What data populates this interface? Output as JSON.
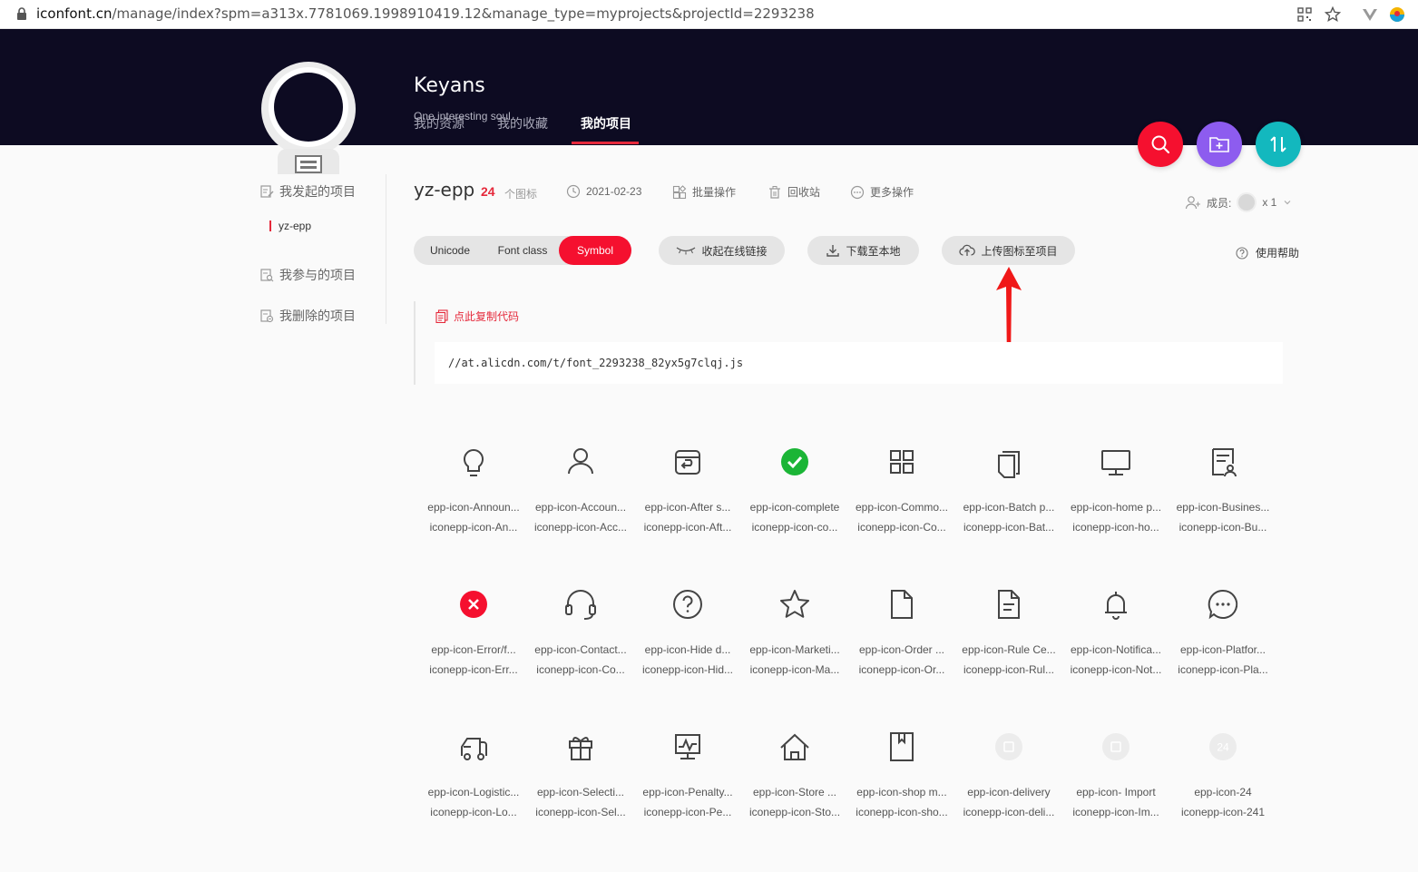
{
  "browser": {
    "url_domain": "iconfont.cn",
    "url_rest": "/manage/index?spm=a313x.7781069.1998910419.12&manage_type=myprojects&projectId=2293238"
  },
  "header": {
    "username": "Keyans",
    "tagline": "One interesting soul",
    "nav": [
      "我的资源",
      "我的收藏",
      "我的项目"
    ]
  },
  "sidebar": {
    "initiated": "我发起的项目",
    "project": "yz-epp",
    "participated": "我参与的项目",
    "deleted": "我删除的项目"
  },
  "project": {
    "name": "yz-epp",
    "count": "24",
    "count_unit": "个图标",
    "date": "2021-02-23",
    "batch": "批量操作",
    "recycle": "回收站",
    "more": "更多操作",
    "members_label": "成员:",
    "members_count": "x 1"
  },
  "toolbar": {
    "tabs": [
      "Unicode",
      "Font class",
      "Symbol"
    ],
    "collapse": "收起在线链接",
    "download": "下载至本地",
    "upload": "上传图标至项目",
    "help": "使用帮助"
  },
  "code": {
    "copy_label": "点此复制代码",
    "link": "//at.alicdn.com/t/font_2293238_82yx5g7clqj.js"
  },
  "icons": [
    {
      "name": "epp-icon-Announ...",
      "code": "iconepp-icon-An...",
      "icon": "bulb-icon"
    },
    {
      "name": "epp-icon-Accoun...",
      "code": "iconepp-icon-Acc...",
      "icon": "user-icon"
    },
    {
      "name": "epp-icon-After s...",
      "code": "iconepp-icon-Aft...",
      "icon": "return-box-icon"
    },
    {
      "name": "epp-icon-complete",
      "code": "iconepp-icon-co...",
      "icon": "check-circle-icon"
    },
    {
      "name": "epp-icon-Commo...",
      "code": "iconepp-icon-Co...",
      "icon": "grid-icon"
    },
    {
      "name": "epp-icon-Batch p...",
      "code": "iconepp-icon-Bat...",
      "icon": "copy-icon"
    },
    {
      "name": "epp-icon-home p...",
      "code": "iconepp-icon-ho...",
      "icon": "monitor-icon"
    },
    {
      "name": "epp-icon-Busines...",
      "code": "iconepp-icon-Bu...",
      "icon": "doc-user-icon"
    },
    {
      "name": "epp-icon-Error/f...",
      "code": "iconepp-icon-Err...",
      "icon": "error-icon"
    },
    {
      "name": "epp-icon-Contact...",
      "code": "iconepp-icon-Co...",
      "icon": "headset-icon"
    },
    {
      "name": "epp-icon-Hide d...",
      "code": "iconepp-icon-Hid...",
      "icon": "question-icon"
    },
    {
      "name": "epp-icon-Marketi...",
      "code": "iconepp-icon-Ma...",
      "icon": "star-icon"
    },
    {
      "name": "epp-icon-Order ...",
      "code": "iconepp-icon-Or...",
      "icon": "file-icon"
    },
    {
      "name": "epp-icon-Rule Ce...",
      "code": "iconepp-icon-Rul...",
      "icon": "file-text-icon"
    },
    {
      "name": "epp-icon-Notifica...",
      "code": "iconepp-icon-Not...",
      "icon": "bell-icon"
    },
    {
      "name": "epp-icon-Platfor...",
      "code": "iconepp-icon-Pla...",
      "icon": "chat-icon"
    },
    {
      "name": "epp-icon-Logistic...",
      "code": "iconepp-icon-Lo...",
      "icon": "truck-icon"
    },
    {
      "name": "epp-icon-Selecti...",
      "code": "iconepp-icon-Sel...",
      "icon": "gift-icon"
    },
    {
      "name": "epp-icon-Penalty...",
      "code": "iconepp-icon-Pe...",
      "icon": "screen-chart-icon"
    },
    {
      "name": "epp-icon-Store ...",
      "code": "iconepp-icon-Sto...",
      "icon": "home-icon"
    },
    {
      "name": "epp-icon-shop m...",
      "code": "iconepp-icon-sho...",
      "icon": "bookmark-icon"
    },
    {
      "name": "epp-icon-delivery",
      "code": "iconepp-icon-deli...",
      "icon": "placeholder-icon"
    },
    {
      "name": "epp-icon- Import",
      "code": "iconepp-icon-Im...",
      "icon": "placeholder-icon"
    },
    {
      "name": "epp-icon-24",
      "code": "iconepp-icon-241",
      "icon": "placeholder-24-icon",
      "badge": "24"
    }
  ],
  "colors": {
    "accent": "#f5102f",
    "header_bg": "#0d0b22",
    "purple": "#8d5cef",
    "teal": "#13b8be",
    "success": "#1bb536"
  }
}
